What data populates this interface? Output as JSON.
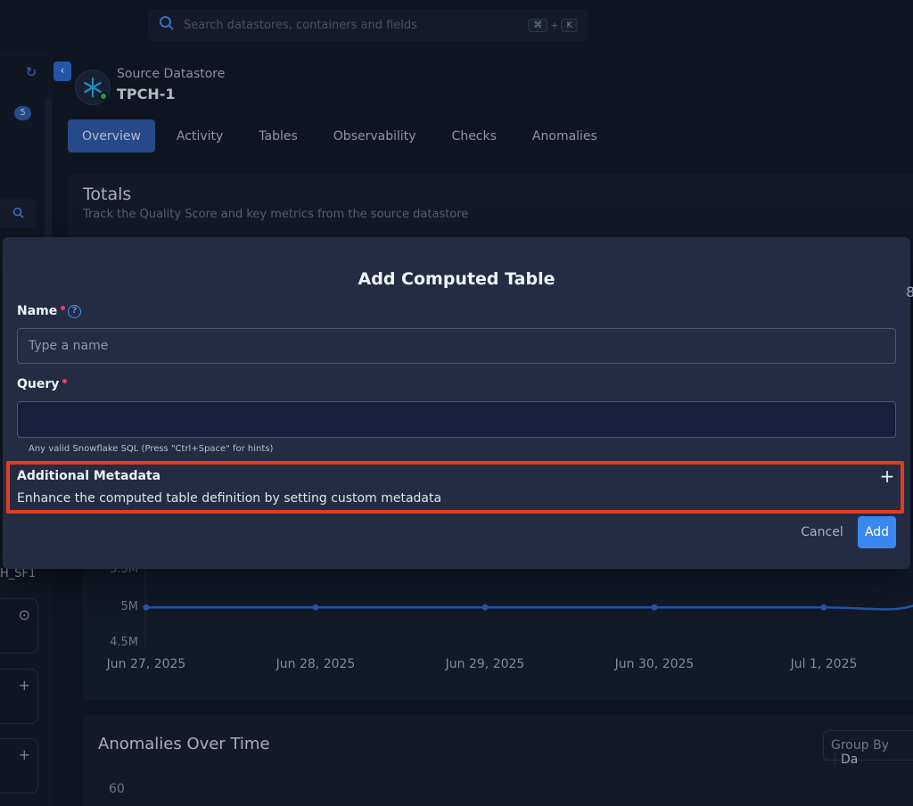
{
  "search": {
    "placeholder": "Search datastores, containers and fields",
    "kbd_cmd": "⌘",
    "kbd_plus": "+",
    "kbd_key": "K"
  },
  "sidebar": {
    "badge_count": "5",
    "datastore_fragment": "H_SF1"
  },
  "datastore": {
    "label": "Source Datastore",
    "name": "TPCH-1"
  },
  "tabs": [
    {
      "label": "Overview",
      "active": true
    },
    {
      "label": "Activity"
    },
    {
      "label": "Tables"
    },
    {
      "label": "Observability"
    },
    {
      "label": "Checks"
    },
    {
      "label": "Anomalies"
    }
  ],
  "totals": {
    "title": "Totals",
    "subtitle": "Track the Quality Score and key metrics from the source datastore"
  },
  "chart_data": {
    "type": "line",
    "x": [
      "Jun 27, 2025",
      "Jun 28, 2025",
      "Jun 29, 2025",
      "Jun 30, 2025",
      "Jul 1, 2025"
    ],
    "series": [
      {
        "values": [
          4.96,
          4.96,
          4.96,
          4.96,
          4.96
        ]
      }
    ],
    "y_tick_labels": [
      "5.5M",
      "5M",
      "4.5M"
    ],
    "color": "#2f6fd6"
  },
  "anomalies": {
    "title": "Anomalies Over Time",
    "group_by_label": "Group By",
    "group_by_value": "Da",
    "y_tick": "60"
  },
  "modal": {
    "title": "Add Computed Table",
    "name_label": "Name",
    "name_placeholder": "Type a name",
    "help_glyph": "?",
    "query_label": "Query",
    "query_value": "",
    "query_hint": "Any valid Snowflake SQL (Press \"Ctrl+Space\" for hints)",
    "meta_title": "Additional Metadata",
    "meta_subtitle": "Enhance the computed table definition by setting custom metadata",
    "cancel_label": "Cancel",
    "add_label": "Add"
  },
  "colors": {
    "accent": "#3b87f0",
    "highlight": "#e33b22",
    "required": "#e5416b",
    "online": "#3bbf5a"
  }
}
